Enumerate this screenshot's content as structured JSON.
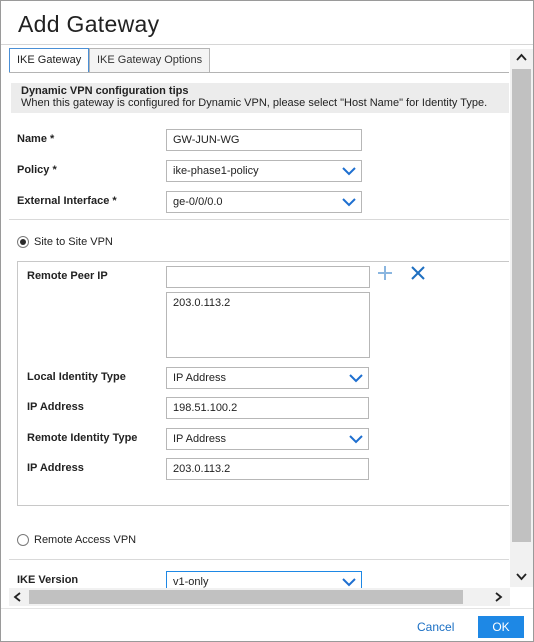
{
  "dialog": {
    "title": "Add Gateway"
  },
  "tabs": [
    {
      "label": "IKE Gateway",
      "active": true
    },
    {
      "label": "IKE Gateway Options",
      "active": false
    }
  ],
  "tips": {
    "heading": "Dynamic VPN configuration tips",
    "text": "When this gateway is configured for Dynamic VPN, please select \"Host Name\" for Identity Type."
  },
  "form": {
    "name_label": "Name *",
    "name_value": "GW-JUN-WG",
    "policy_label": "Policy *",
    "policy_value": "ike-phase1-policy",
    "ext_iface_label": "External Interface *",
    "ext_iface_value": "ge-0/0/0.0"
  },
  "site_to_site": {
    "label": "Site to Site VPN",
    "selected": true,
    "remote_peer_ip_label": "Remote Peer IP",
    "remote_peer_ip_value": "",
    "remote_peer_list": "203.0.113.2",
    "local_identity_type_label": "Local Identity Type",
    "local_identity_type_value": "IP Address",
    "local_ip_label": "IP Address",
    "local_ip_value": "198.51.100.2",
    "remote_identity_type_label": "Remote Identity Type",
    "remote_identity_type_value": "IP Address",
    "remote_ip_label": "IP Address",
    "remote_ip_value": "203.0.113.2"
  },
  "remote_access": {
    "label": "Remote Access VPN",
    "selected": false
  },
  "ike_version": {
    "label": "IKE Version",
    "value": "v1-only"
  },
  "footer": {
    "cancel_label": "Cancel",
    "ok_label": "OK"
  },
  "icons": {
    "add": "plus-icon",
    "remove": "close-icon",
    "dropdown": "chevron-down-icon",
    "scroll_up": "triangle-up-icon",
    "scroll_down": "triangle-down-icon",
    "scroll_left": "triangle-left-icon",
    "scroll_right": "triangle-right-icon"
  },
  "colors": {
    "accent": "#1e88e5",
    "add_icon": "#8ab6e0",
    "remove_icon": "#1f6fc0",
    "chevron": "#1e6fd0"
  }
}
